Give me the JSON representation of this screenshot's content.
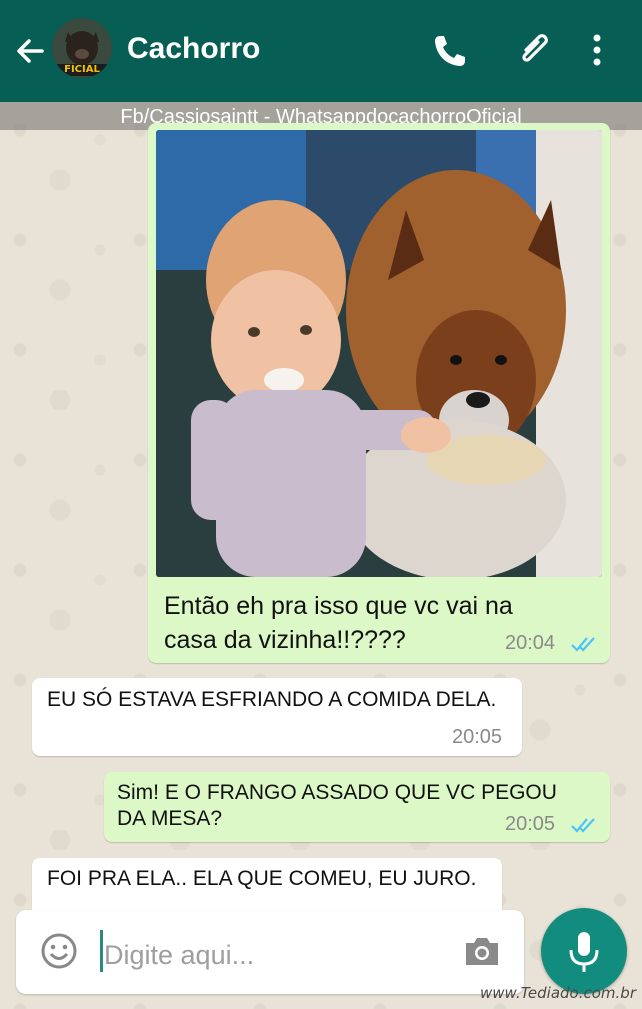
{
  "header": {
    "title": "Cachorro",
    "avatar_text": "FICIAL",
    "back_icon": "arrow-left-icon",
    "actions": [
      "phone-icon",
      "paperclip-icon",
      "more-vertical-icon"
    ],
    "color": "#075e54"
  },
  "watermark": {
    "text": "Fb/Cassiosaintt -  WhatsappdocachorroOficial"
  },
  "messages": [
    {
      "direction": "out",
      "has_photo": true,
      "lines": [
        "Então eh pra isso que vc vai na",
        "casa da vizinha!!????"
      ],
      "time": "20:04",
      "ticks": "double-check-blue"
    },
    {
      "direction": "in",
      "lines": [
        "EU SÓ ESTAVA ESFRIANDO A COMIDA DELA."
      ],
      "time": "20:05"
    },
    {
      "direction": "out",
      "lines": [
        "Sim!  E O FRANGO ASSADO QUE VC PEGOU",
        "DA MESA?"
      ],
      "time": "20:05",
      "ticks": "double-check-blue"
    },
    {
      "direction": "in",
      "lines": [
        "FOI PRA ELA..  ELA QUE COMEU,  EU JURO."
      ],
      "time": ""
    }
  ],
  "composer": {
    "placeholder": "Digite aqui...",
    "emoji_icon": "emoji-icon",
    "camera_icon": "camera-icon",
    "mic_icon": "mic-icon"
  },
  "footer": {
    "site": "www.Tediado.com.br"
  },
  "colors": {
    "out_bubble": "#dcf8c6",
    "in_bubble": "#ffffff",
    "tick_blue": "#4fc3f7",
    "mic_button": "#128c7e"
  }
}
